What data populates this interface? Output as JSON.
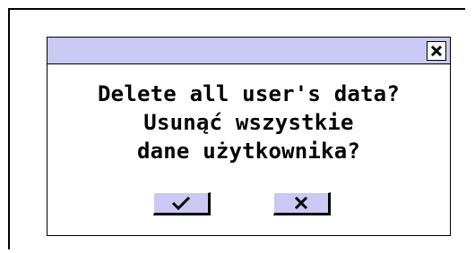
{
  "dialog": {
    "message_lines": [
      "Delete all user's data?",
      "Usunąć wszystkie",
      "dane użytkownika?"
    ],
    "icons": {
      "close": "close-icon",
      "confirm": "checkmark-icon",
      "cancel": "x-icon"
    }
  },
  "colors": {
    "accent": "#c9c9f4",
    "border": "#000000",
    "background": "#ffffff"
  }
}
